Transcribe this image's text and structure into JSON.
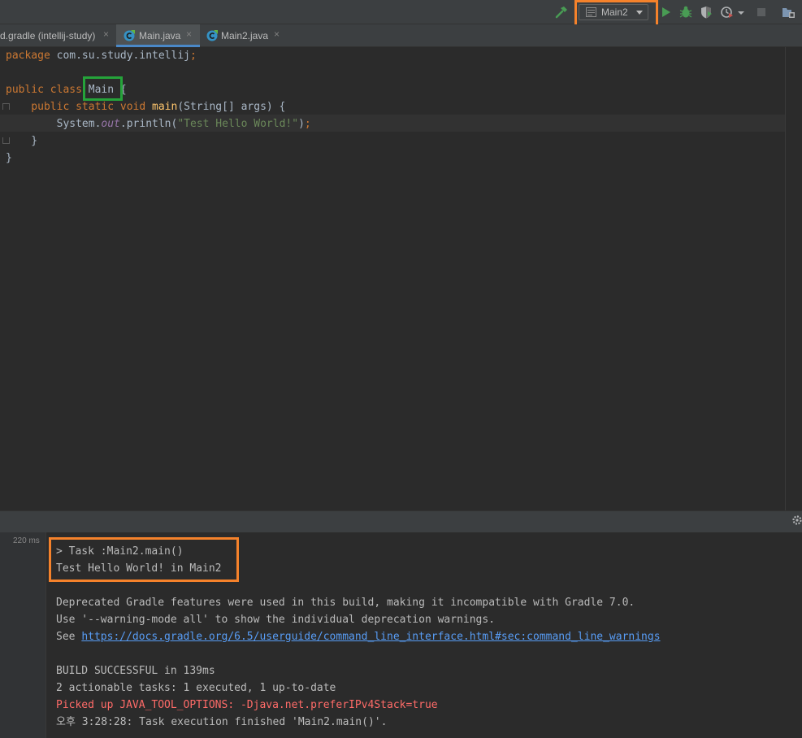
{
  "toolbar": {
    "run_config": "Main2",
    "icons": [
      "build-hammer-icon",
      "run-config-icon",
      "chevron-down-icon",
      "run-icon",
      "debug-icon",
      "coverage-icon",
      "profiler-icon",
      "stop-icon",
      "project-structure-icon"
    ]
  },
  "tabs": [
    {
      "label": "d.gradle (intellij-study)",
      "close": "×",
      "active": false
    },
    {
      "label": "Main.java",
      "close": "×",
      "active": true,
      "icon": "java-class-icon"
    },
    {
      "label": "Main2.java",
      "close": "×",
      "active": false,
      "icon": "java-class-icon"
    }
  ],
  "editor": {
    "lines": [
      {
        "tokens": [
          {
            "t": "package ",
            "c": "kw"
          },
          {
            "t": "com.su.study.intellij",
            "c": "pl"
          },
          {
            "t": ";",
            "c": "kw"
          }
        ]
      },
      {
        "tokens": []
      },
      {
        "tokens": [
          {
            "t": "public class ",
            "c": "kw"
          },
          {
            "t": "Main",
            "c": "pl"
          },
          {
            "t": " {",
            "c": "pl"
          }
        ]
      },
      {
        "tokens": [
          {
            "t": "    public static void ",
            "c": "kw"
          },
          {
            "t": "main",
            "c": "fn"
          },
          {
            "t": "(String[] args) {",
            "c": "pl"
          }
        ]
      },
      {
        "tokens": [
          {
            "t": "        System.",
            "c": "pl"
          },
          {
            "t": "out",
            "c": "fi"
          },
          {
            "t": ".println(",
            "c": "pl"
          },
          {
            "t": "\"Test Hello World!\"",
            "c": "st"
          },
          {
            "t": ")",
            "c": "pl"
          },
          {
            "t": ";",
            "c": "kw"
          }
        ]
      },
      {
        "tokens": [
          {
            "t": "    }",
            "c": "pl"
          }
        ]
      },
      {
        "tokens": [
          {
            "t": "}",
            "c": "pl"
          }
        ]
      }
    ]
  },
  "run_panel": {
    "duration": "220 ms",
    "lines": [
      {
        "text": "> Task :Main2.main()",
        "kind": "normal"
      },
      {
        "text": "Test Hello World! in Main2",
        "kind": "normal"
      },
      {
        "text": "",
        "kind": "normal"
      },
      {
        "text": "Deprecated Gradle features were used in this build, making it incompatible with Gradle 7.0.",
        "kind": "normal"
      },
      {
        "text": "Use '--warning-mode all' to show the individual deprecation warnings.",
        "kind": "normal"
      },
      {
        "text": "See ",
        "kind": "normal",
        "link": "https://docs.gradle.org/6.5/userguide/command_line_interface.html#sec:command_line_warnings"
      },
      {
        "text": "",
        "kind": "normal"
      },
      {
        "text": "BUILD SUCCESSFUL in 139ms",
        "kind": "normal"
      },
      {
        "text": "2 actionable tasks: 1 executed, 1 up-to-date",
        "kind": "normal"
      },
      {
        "text": "Picked up JAVA_TOOL_OPTIONS: -Djava.net.preferIPv4Stack=true",
        "kind": "err"
      },
      {
        "text": "오후 3:28:28: Task execution finished 'Main2.main()'.",
        "kind": "normal"
      }
    ]
  },
  "colors": {
    "highlight_orange": "#f5822b",
    "highlight_green": "#25a33a",
    "run_green": "#499c54",
    "link_blue": "#589df6",
    "error_red": "#ff6b68"
  }
}
